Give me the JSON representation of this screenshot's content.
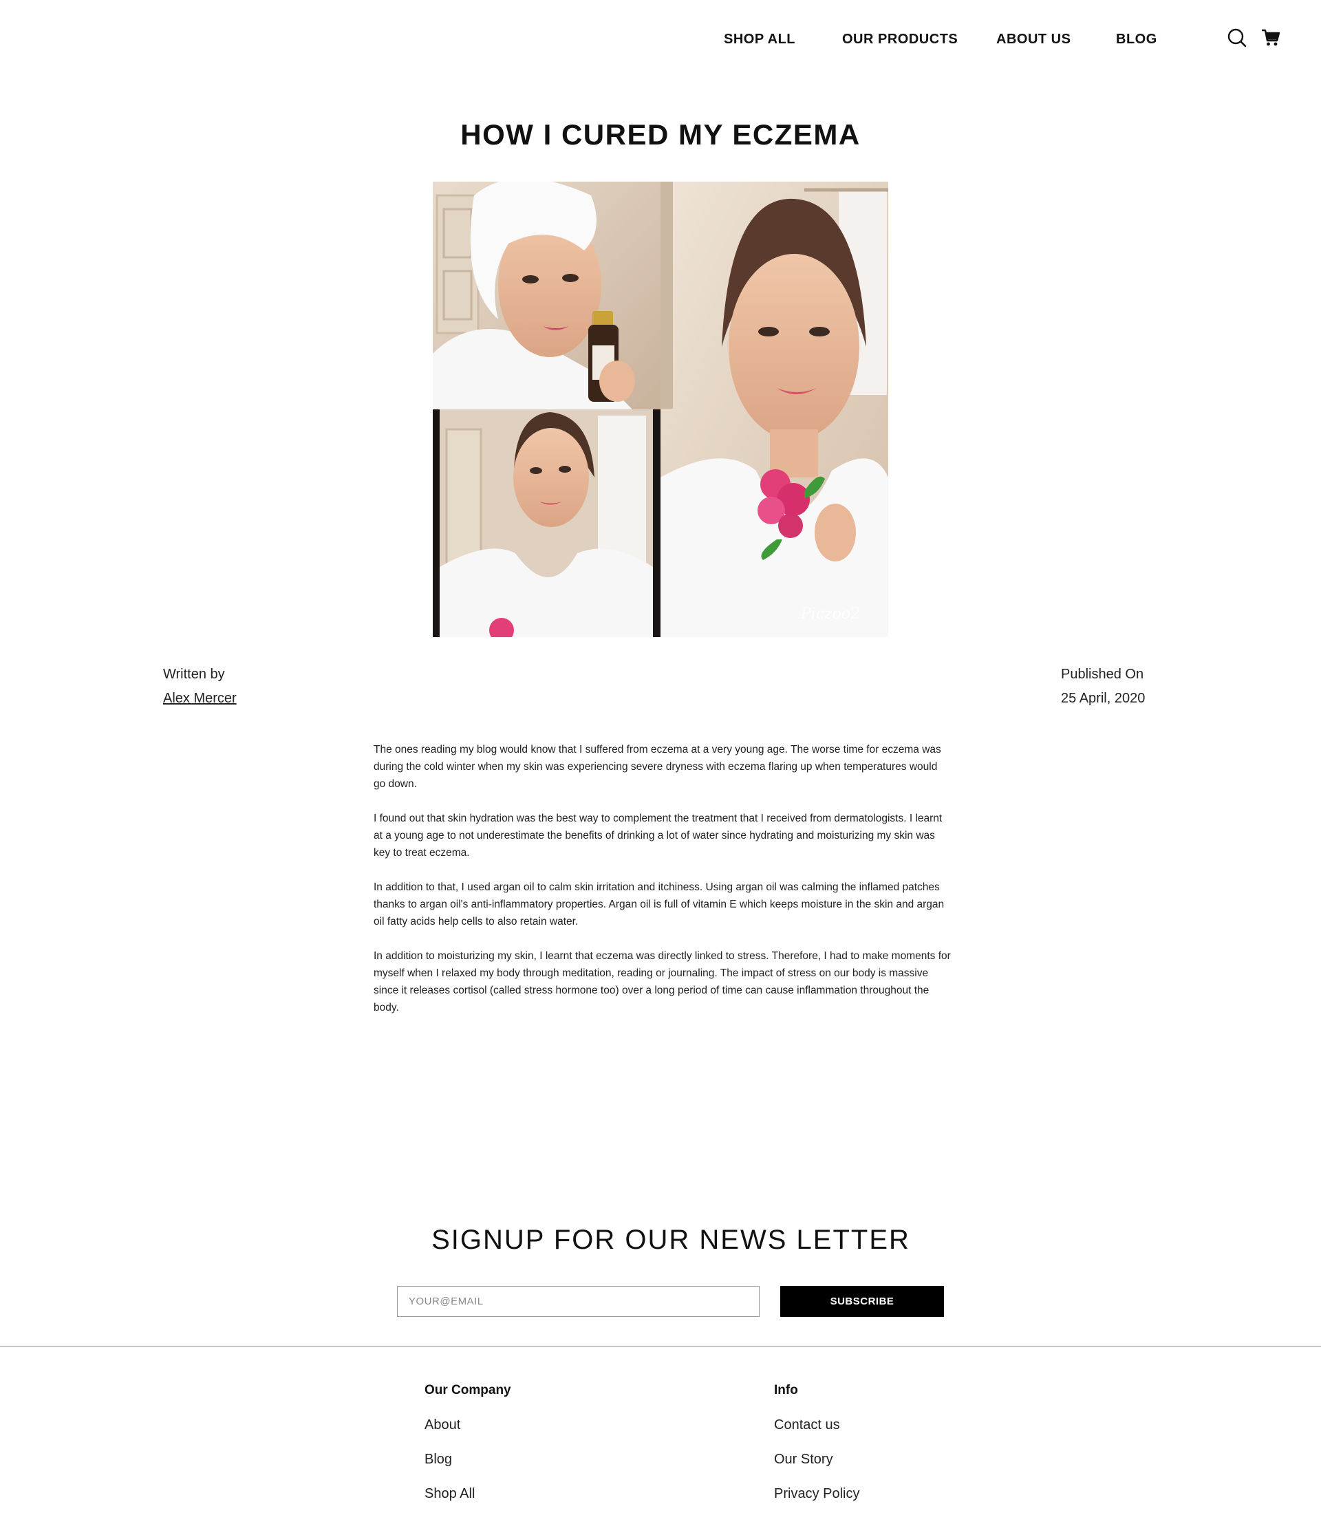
{
  "header": {
    "nav": [
      "SHOP ALL",
      "OUR PRODUCTS",
      "ABOUT US",
      "BLOG"
    ],
    "icons": [
      "search-icon",
      "cart-icon"
    ]
  },
  "post": {
    "title": "HOW I CURED MY ECZEMA",
    "image_watermark": "Piczoo2",
    "written_by_label": "Written by",
    "author": "Alex Mercer",
    "published_label": "Published On",
    "published_date": "25 April, 2020",
    "paragraphs": [
      "The ones reading my blog would know that I suffered from eczema at a very young age. The worse time for eczema was during the cold winter when my skin was experiencing severe dryness with eczema flaring up when temperatures would go down.",
      "I found out that skin hydration was the best way to complement the treatment that I received from dermatologists. I learnt at a young age to not underestimate the benefits of drinking a lot of water since hydrating and moisturizing my skin was key to treat eczema.",
      "In addition to that, I used argan oil to calm skin irritation and itchiness. Using argan oil was calming the inflamed patches thanks to argan oil's anti-inflammatory properties. Argan oil is full of vitamin E which keeps moisture in the skin and argan oil fatty acids help cells to also retain water.",
      "In addition to moisturizing my skin, I learnt that eczema was directly linked to stress. Therefore, I had to make moments for myself when I relaxed my body through meditation, reading or journaling. The impact of stress on our body is massive since it releases cortisol (called stress hormone too) over a long period of time can cause inflammation throughout the body."
    ]
  },
  "newsletter": {
    "title": "SIGNUP FOR OUR NEWS LETTER",
    "placeholder": "YOUR@EMAIL",
    "button": "SUBSCRIBE"
  },
  "footer": {
    "company_heading": "Our Company",
    "company_links": [
      "About",
      "Blog",
      "Shop All"
    ],
    "info_heading": "Info",
    "info_links": [
      "Contact us",
      "Our Story",
      "Privacy Policy"
    ]
  },
  "colors": {
    "text": "#111111",
    "button_bg": "#000000",
    "button_text": "#ffffff",
    "divider": "#8a8a8a"
  }
}
